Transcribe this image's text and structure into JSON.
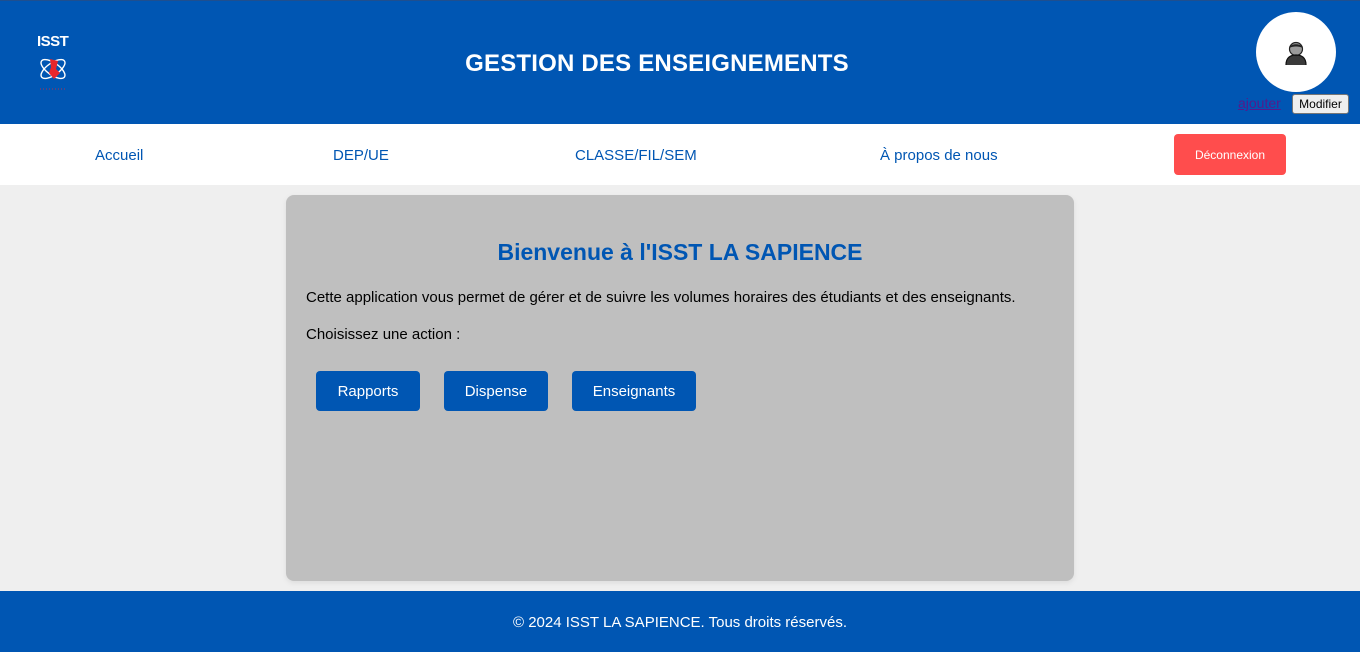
{
  "header": {
    "logo_text": "ISST",
    "logo_icon": "atom-logo-icon",
    "title": "GESTION DES ENSEIGNEMENTS",
    "avatar_icon": "user-icon",
    "add_link": "ajouter",
    "modify_button": "Modifier"
  },
  "nav": {
    "items": [
      {
        "label": "Accueil"
      },
      {
        "label": "DEP/UE"
      },
      {
        "label": "CLASSE/FIL/SEM"
      },
      {
        "label": "À propos de nous"
      }
    ],
    "logout": "Déconnexion"
  },
  "main": {
    "title": "Bienvenue à l'ISST LA SAPIENCE",
    "description": "Cette application vous permet de gérer et de suivre les volumes horaires des étudiants et des enseignants.",
    "prompt": "Choisissez une action :",
    "actions": [
      {
        "label": "Rapports"
      },
      {
        "label": "Dispense"
      },
      {
        "label": "Enseignants"
      }
    ]
  },
  "footer": {
    "text": "© 2024 ISST LA SAPIENCE. Tous droits réservés."
  },
  "colors": {
    "primary": "#0056b3",
    "logout": "#ff4d4d",
    "card": "#bfbfbf",
    "background": "#efefef"
  }
}
